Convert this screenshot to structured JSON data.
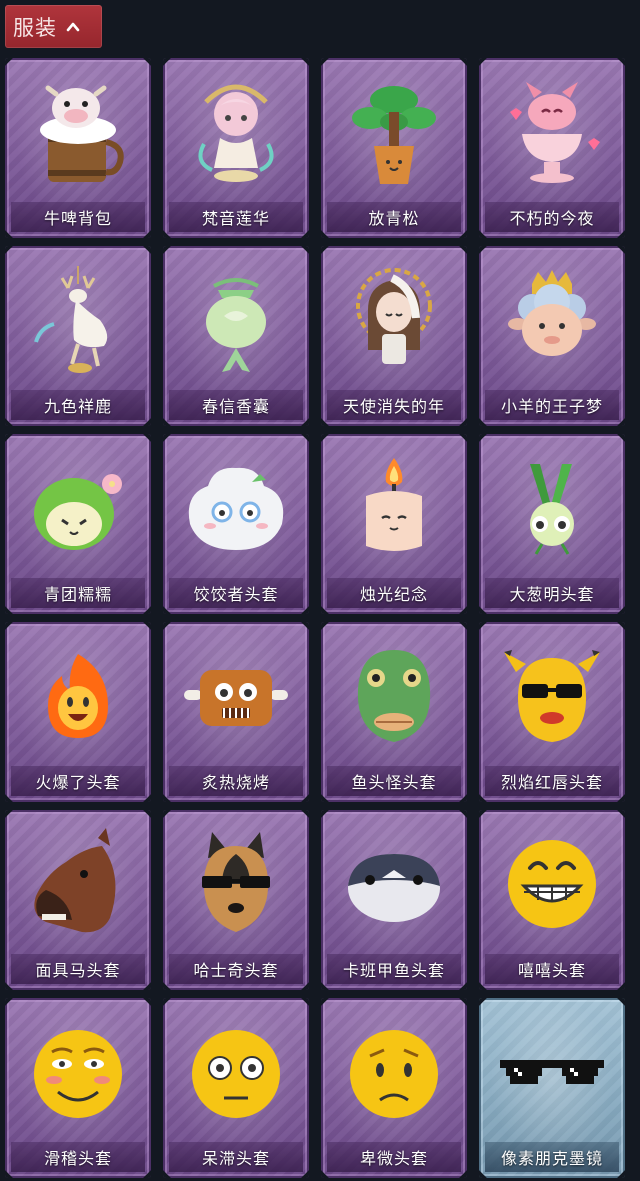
{
  "header": {
    "title": "服装",
    "toggle_icon": "chevron-up-icon"
  },
  "items": [
    {
      "label": "牛啤背包",
      "icon": "cow-beer-backpack"
    },
    {
      "label": "梵音莲华",
      "icon": "lotus-fairy-figure"
    },
    {
      "label": "放青松",
      "icon": "potted-pine-tree"
    },
    {
      "label": "不朽的今夜",
      "icon": "pink-fox-in-bowl"
    },
    {
      "label": "九色祥鹿",
      "icon": "deer-ornament"
    },
    {
      "label": "春信香囊",
      "icon": "green-sachet"
    },
    {
      "label": "天使消失的年",
      "icon": "angel-girl-figure"
    },
    {
      "label": "小羊的王子梦",
      "icon": "crowned-sheep"
    },
    {
      "label": "青团糯糯",
      "icon": "green-rice-ball-head"
    },
    {
      "label": "饺饺者头套",
      "icon": "dumpling-head"
    },
    {
      "label": "烛光纪念",
      "icon": "candle-head"
    },
    {
      "label": "大葱明头套",
      "icon": "green-onion-head"
    },
    {
      "label": "火爆了头套",
      "icon": "fire-head"
    },
    {
      "label": "炙热烧烤",
      "icon": "grilled-meat-head"
    },
    {
      "label": "鱼头怪头套",
      "icon": "fish-mask-head"
    },
    {
      "label": "烈焰红唇头套",
      "icon": "yellow-mask-sunglasses"
    },
    {
      "label": "面具马头套",
      "icon": "horse-mask-head"
    },
    {
      "label": "哈士奇头套",
      "icon": "husky-head"
    },
    {
      "label": "卡班甲鱼头套",
      "icon": "round-fish-head"
    },
    {
      "label": "嘻嘻头套",
      "icon": "grin-emoji-head"
    },
    {
      "label": "滑稽头套",
      "icon": "funny-emoji-head"
    },
    {
      "label": "呆滞头套",
      "icon": "stunned-emoji-head"
    },
    {
      "label": "卑微头套",
      "icon": "humble-emoji-head"
    },
    {
      "label": "像素朋克墨镜",
      "icon": "pixel-sunglasses"
    }
  ]
}
